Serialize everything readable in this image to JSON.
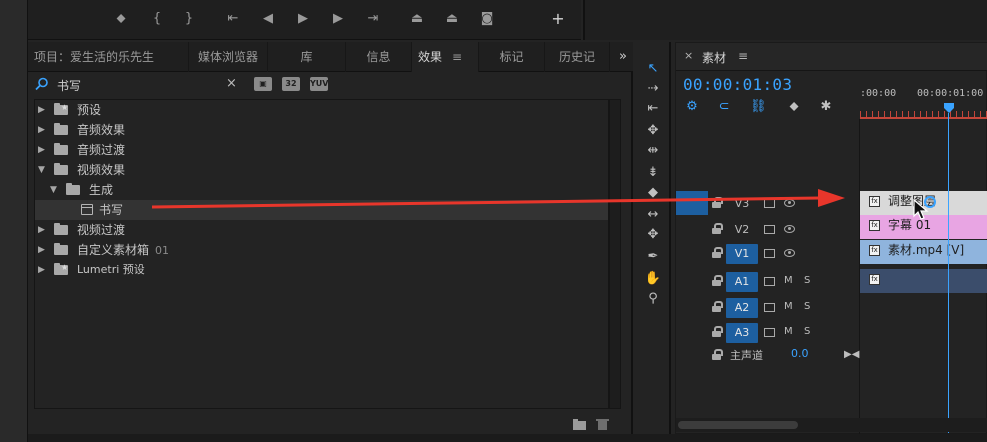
{
  "effects_panel": {
    "tabs": [
      {
        "label": "项目：爱生活的乐先生"
      },
      {
        "label": "媒体浏览器"
      },
      {
        "label": "库"
      },
      {
        "label": "信息"
      },
      {
        "label": "效果",
        "menu": "≡"
      },
      {
        "label": "标记"
      },
      {
        "label": "历史记"
      }
    ],
    "overflow": "»",
    "search": {
      "value": "书写",
      "clear": "×",
      "filters": [
        "32",
        "YUV"
      ]
    },
    "tree": [
      {
        "label": "预设"
      },
      {
        "label": "音频效果"
      },
      {
        "label": "音频过渡"
      },
      {
        "label": "视频效果"
      },
      {
        "label": "生成"
      },
      {
        "label": "书写"
      },
      {
        "label": "视频过渡"
      },
      {
        "label": "自定义素材箱",
        "suffix": "01"
      },
      {
        "label": "Lumetri 预设"
      }
    ]
  },
  "timeline": {
    "close": "×",
    "title": "素材",
    "menu": "≡",
    "timecode": "00:00:01:03",
    "ruler_labels": [
      ":00:00",
      "00:00:01:00"
    ],
    "tracks": {
      "v3": {
        "name": "V3"
      },
      "v2": {
        "name": "V2"
      },
      "v1": {
        "name": "V1"
      },
      "a1": {
        "name": "A1",
        "m": "M",
        "s": "S"
      },
      "a2": {
        "name": "A2",
        "m": "M",
        "s": "S"
      },
      "a3": {
        "name": "A3",
        "m": "M",
        "s": "S"
      }
    },
    "master": {
      "label": "主声道",
      "value": "0.0"
    },
    "clips": {
      "adjust": "调整图层",
      "title": "字幕 01",
      "video": "素材.mp4 [V]"
    },
    "fx_badge": "fx"
  },
  "colors": {
    "accent": "#3aa3ff",
    "arrow": "#e8362b",
    "adjustment_clip": "#d9d9d9",
    "title_clip": "#e8a5e3",
    "video_clip": "#8fb4dd",
    "audio_clip": "#3b4d6b",
    "target_track": "#1d5fa0"
  }
}
